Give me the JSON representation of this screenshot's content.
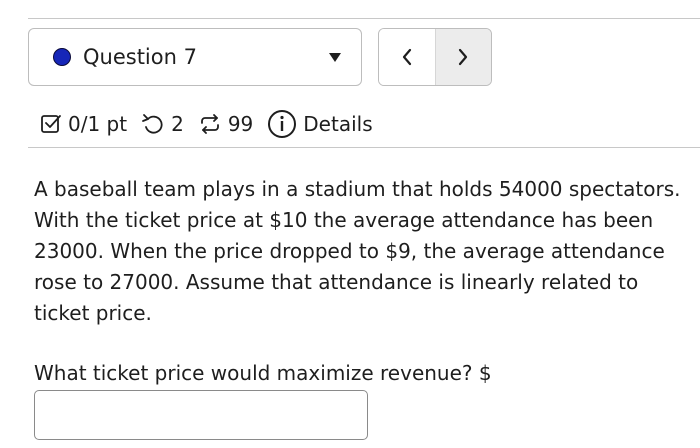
{
  "question_selector": {
    "label": "Question 7",
    "status_color": "#1626b8"
  },
  "nav": {
    "prev_symbol": "‹",
    "next_symbol": "›"
  },
  "meta": {
    "points": "0/1 pt",
    "retries": "2",
    "attempts": "99",
    "details_label": "Details"
  },
  "problem": {
    "text": "A baseball team plays in a stadium that holds 54000 spectators. With the ticket price at $10 the average attendance has been 23000. When the price dropped to $9, the average attendance rose to 27000. Assume that attendance is linearly related to ticket price.",
    "prompt": "What ticket price would maximize revenue? $",
    "answer_value": ""
  },
  "icons": {
    "status": "filled-circle-icon",
    "dropdown": "caret-down-icon",
    "prev": "chevron-left-icon",
    "next": "chevron-right-icon",
    "points": "checkbox-icon",
    "retries": "undo-arrow-icon",
    "attempts": "repeat-arrows-icon",
    "details": "info-circle-icon"
  }
}
